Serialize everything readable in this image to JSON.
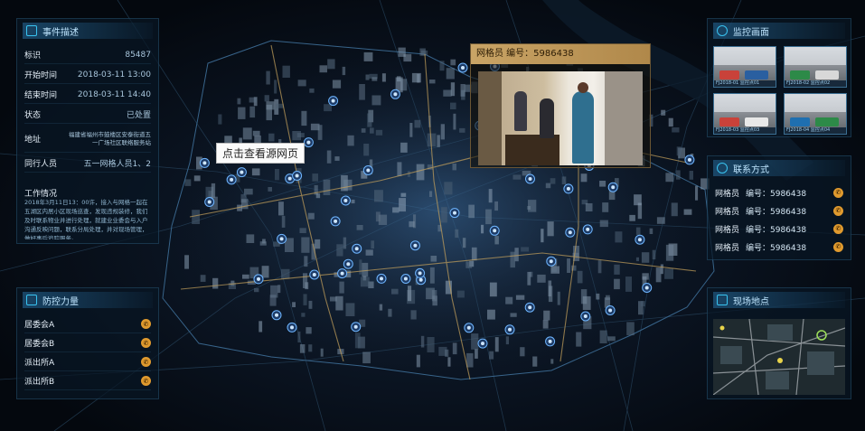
{
  "event": {
    "title": "事件描述",
    "fields": [
      {
        "label": "标识",
        "value": "85487"
      },
      {
        "label": "开始时间",
        "value": "2018-03-11  13:00"
      },
      {
        "label": "结束时间",
        "value": "2018-03-11  14:40"
      },
      {
        "label": "状态",
        "value": "已处置"
      },
      {
        "label": "地址",
        "value": "福建省福州市鼓楼区安泰街道五一广场社区联络服务站"
      },
      {
        "label": "同行人员",
        "value": "五一网格人员1、2"
      }
    ],
    "work_label": "工作情况",
    "work_text": "2018年3月11日13：00许，接入与网格一起在五湖区内居小区现场巡查，发现违规装修，我们及时联系物业并进行处理，就建业业委会与入户沟通反映问题，联系分局处理，并对现场管理，做好事后追踪服务。"
  },
  "force": {
    "title": "防控力量",
    "items": [
      {
        "label": "居委会A"
      },
      {
        "label": "居委会B"
      },
      {
        "label": "派出所A"
      },
      {
        "label": "派出所B"
      }
    ]
  },
  "video": {
    "header": "网格员   编号：5986438"
  },
  "tooltip": "点击查看源网页",
  "monitor": {
    "title": "监控画面",
    "captions": [
      "FJ2018-01 监控点01",
      "FJ2018-02 监控点02",
      "FJ2018-03 监控点03",
      "FJ2018-04 监控点04"
    ]
  },
  "contact": {
    "title": "联系方式",
    "items": [
      {
        "role": "网格员",
        "code": "编号：5986438"
      },
      {
        "role": "网格员",
        "code": "编号：5986438"
      },
      {
        "role": "网格员",
        "code": "编号：5986438"
      },
      {
        "role": "网格员",
        "code": "编号：5986438"
      }
    ]
  },
  "location": {
    "title": "现场地点"
  },
  "icons": {
    "event": "document-icon",
    "force": "shield-icon",
    "monitor": "camera-icon",
    "contact": "phone-icon",
    "location": "map-pin-icon",
    "call": "phone-call-icon"
  },
  "colors": {
    "accent": "#39c3f0",
    "call": "#e09a2e",
    "poi": "#6fb6ff"
  }
}
